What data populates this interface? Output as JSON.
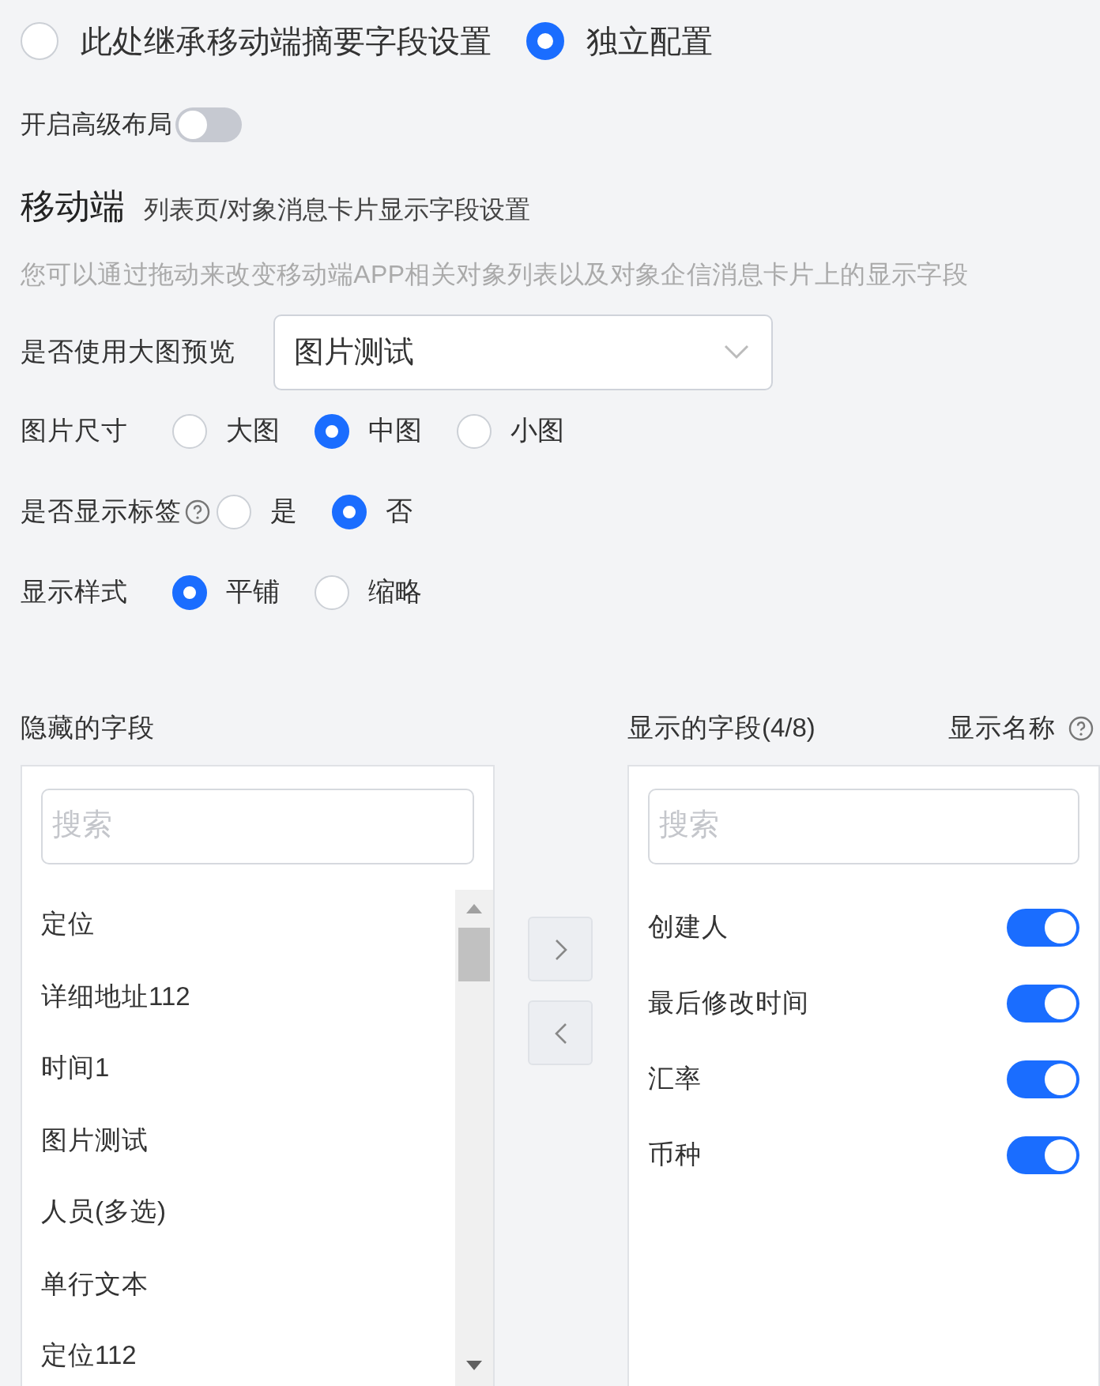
{
  "inherit_options": [
    {
      "label": "此处继承移动端摘要字段设置",
      "selected": false
    },
    {
      "label": "独立配置",
      "selected": true
    }
  ],
  "advanced_layout": {
    "label": "开启高级布局",
    "on": false
  },
  "section": {
    "title": "移动端",
    "subtitle": "列表页/对象消息卡片显示字段设置",
    "description": "您可以通过拖动来改变移动端APP相关对象列表以及对象企信消息卡片上的显示字段"
  },
  "form": [
    {
      "kind": "select",
      "label": "是否使用大图预览",
      "help": false,
      "value": "图片测试"
    },
    {
      "kind": "radio",
      "label": "图片尺寸",
      "help": false,
      "options": [
        {
          "label": "大图",
          "selected": false
        },
        {
          "label": "中图",
          "selected": true
        },
        {
          "label": "小图",
          "selected": false
        }
      ]
    },
    {
      "kind": "radio",
      "label": "是否显示标签",
      "help": true,
      "options": [
        {
          "label": "是",
          "selected": false
        },
        {
          "label": "否",
          "selected": true
        }
      ]
    },
    {
      "kind": "radio",
      "label": "显示样式",
      "help": false,
      "options": [
        {
          "label": "平铺",
          "selected": true
        },
        {
          "label": "缩略",
          "selected": false
        }
      ]
    }
  ],
  "hidden_fields": {
    "title": "隐藏的字段",
    "search": {
      "placeholder": "搜索"
    },
    "items": [
      "定位",
      "详细地址112",
      "时间1",
      "图片测试",
      "人员(多选)",
      "单行文本",
      "定位112"
    ]
  },
  "shown_fields": {
    "title": "显示的字段(4/8)",
    "name_toggle_label": "显示名称",
    "search": {
      "placeholder": "搜索"
    },
    "items": [
      {
        "label": "创建人",
        "on": true
      },
      {
        "label": "最后修改时间",
        "on": true
      },
      {
        "label": "汇率",
        "on": true
      },
      {
        "label": "币种",
        "on": true
      }
    ]
  }
}
